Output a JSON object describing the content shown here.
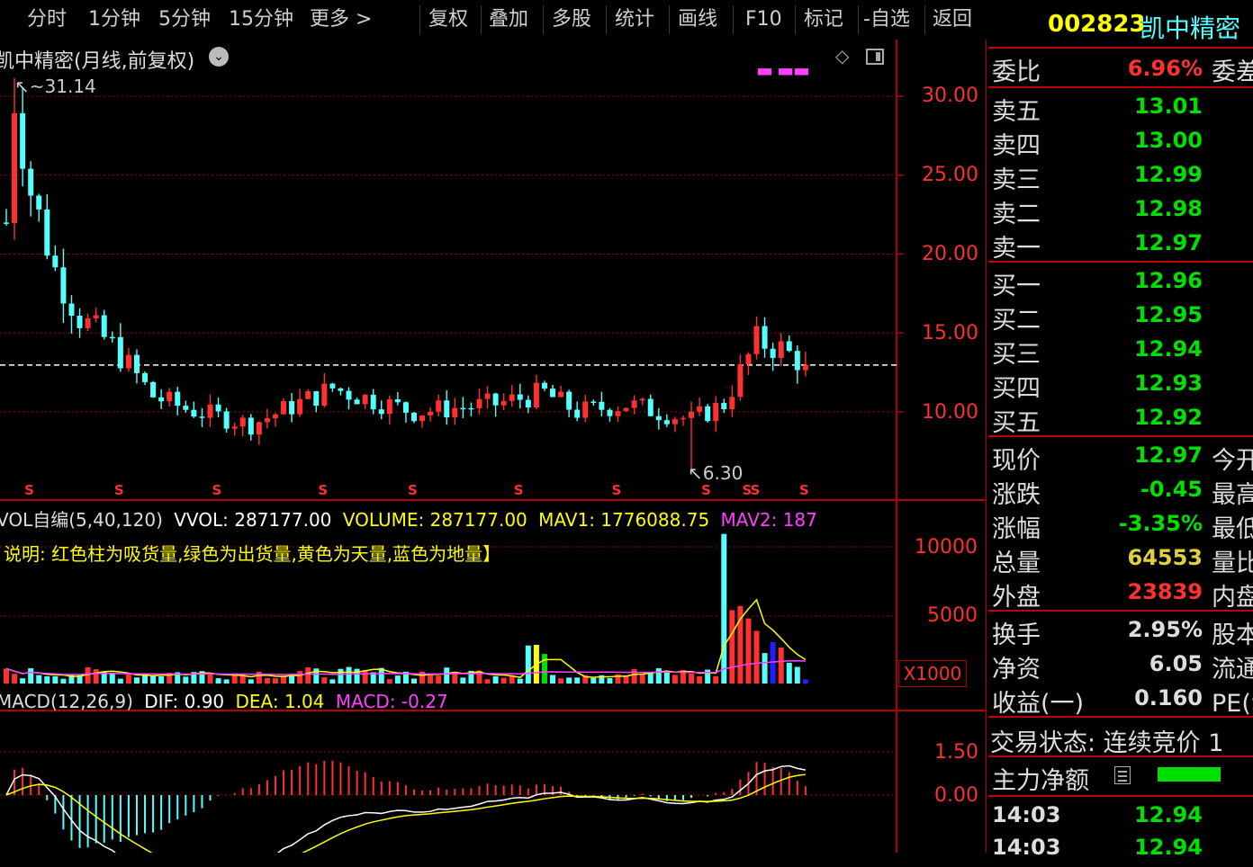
{
  "toolbar": {
    "items": [
      "分时",
      "1分钟",
      "5分钟",
      "15分钟",
      "更多 >",
      "复权",
      "叠加",
      "多股",
      "统计",
      "画线",
      "F10",
      "标记",
      "-自选",
      "返回"
    ]
  },
  "main_chart": {
    "title": "凯中精密(月线,前复权)",
    "high_label": "31.14",
    "low_label": "6.30",
    "y_ticks": [
      "30.00",
      "25.00",
      "20.00",
      "15.00",
      "10.00"
    ],
    "signal_marker": "S",
    "current_price": 12.97
  },
  "volume_panel": {
    "header": {
      "name": "VOL自编(5,40,120)",
      "vvol": "VVOL: 287177.00",
      "volume": "VOLUME: 287177.00",
      "mav1": "MAV1: 1776088.75",
      "mav2": "MAV2: 187"
    },
    "note": "说明: 红色柱为吸货量,绿色为出货量,黄色为天量,蓝色为地量】",
    "y_ticks": [
      "10000",
      "5000"
    ],
    "unit": "X1000"
  },
  "macd_panel": {
    "header": {
      "name": "MACD(12,26,9)",
      "dif": "DIF: 0.90",
      "dea": "DEA: 1.04",
      "macd": "MACD: -0.27"
    },
    "y_ticks": [
      "1.50",
      "0.00"
    ]
  },
  "quote": {
    "code": "002823",
    "name": "凯中精密",
    "weibi_label": "委比",
    "weibi_value": "6.96%",
    "weibi_cut": "委差",
    "asks": [
      {
        "label": "卖五",
        "price": "13.01"
      },
      {
        "label": "卖四",
        "price": "13.00"
      },
      {
        "label": "卖三",
        "price": "12.99"
      },
      {
        "label": "卖二",
        "price": "12.98"
      },
      {
        "label": "卖一",
        "price": "12.97"
      }
    ],
    "bids": [
      {
        "label": "买一",
        "price": "12.96"
      },
      {
        "label": "买二",
        "price": "12.95"
      },
      {
        "label": "买三",
        "price": "12.94"
      },
      {
        "label": "买四",
        "price": "12.93"
      },
      {
        "label": "买五",
        "price": "12.92"
      }
    ],
    "stats": [
      {
        "label": "现价",
        "value": "12.97",
        "cut": "今开"
      },
      {
        "label": "涨跌",
        "value": "-0.45",
        "cut": "最高"
      },
      {
        "label": "涨幅",
        "value": "-3.35%",
        "cut": "最低"
      },
      {
        "label": "总量",
        "value": "64553",
        "cut": "量比"
      },
      {
        "label": "外盘",
        "value": "23839",
        "cut": "内盘"
      }
    ],
    "stats2": [
      {
        "label": "换手",
        "value": "2.95%",
        "cut": "股本"
      },
      {
        "label": "净资",
        "value": "6.05",
        "cut": "流通"
      },
      {
        "label": "收益(一)",
        "value": "0.160",
        "cut": "PE(动"
      }
    ],
    "trade_status": "交易状态: 连续竞价 1",
    "main_force": "主力净额",
    "ticks": [
      {
        "time": "14:03",
        "price": "12.94"
      },
      {
        "time": "14:03",
        "price": "12.94"
      }
    ]
  },
  "colors": {
    "up": "#ff3030",
    "down": "#54ffff",
    "green": "#00e000",
    "yellow": "#ffff00",
    "magenta": "#ff40ff",
    "grid": "#b00000",
    "axis": "#ff3030",
    "white": "#ffffff"
  }
}
